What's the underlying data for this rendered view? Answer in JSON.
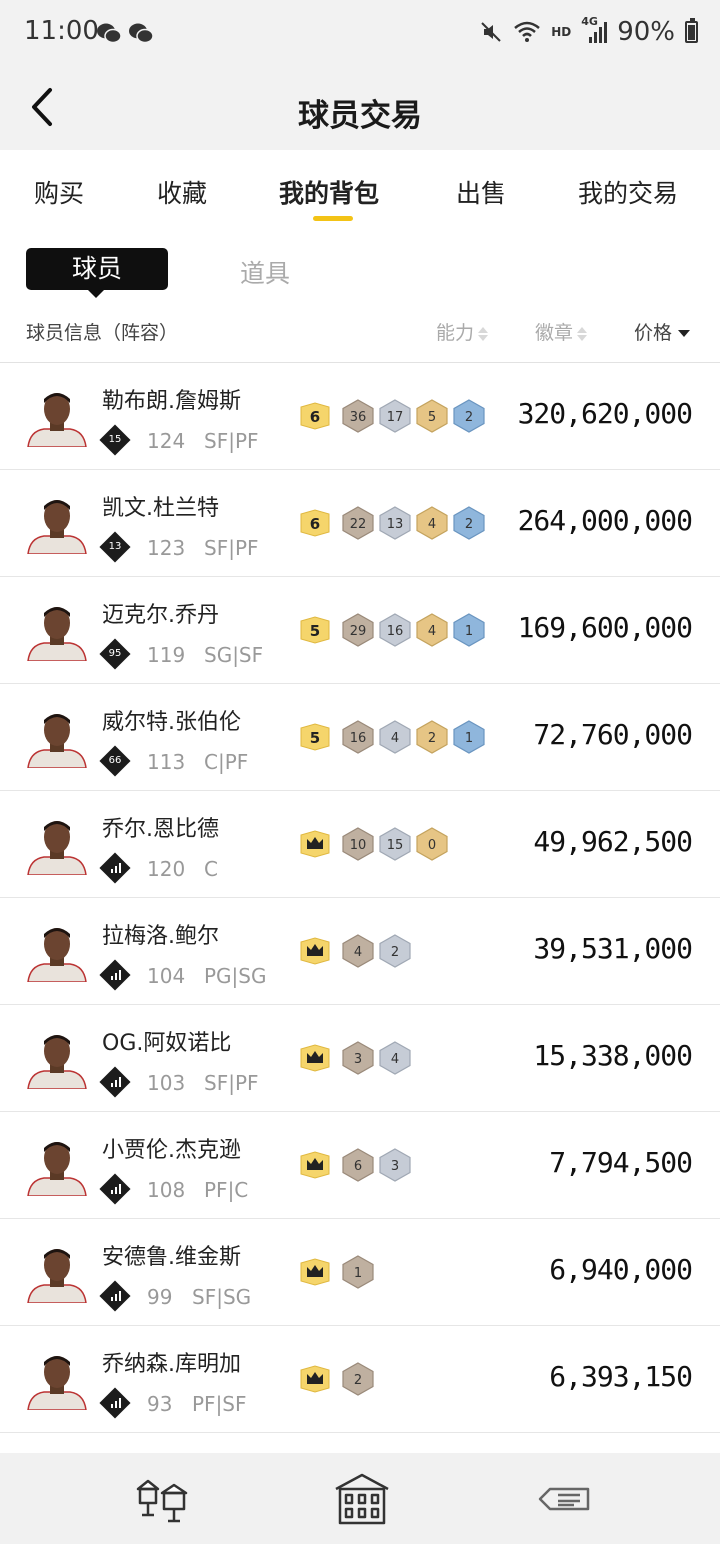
{
  "status": {
    "time": "11:00",
    "hd": "HD",
    "net": "4G",
    "battery": "90%"
  },
  "header": {
    "title": "球员交易"
  },
  "tabs": [
    {
      "label": "购买"
    },
    {
      "label": "收藏"
    },
    {
      "label": "我的背包"
    },
    {
      "label": "出售"
    },
    {
      "label": "我的交易"
    }
  ],
  "segment": {
    "player": "球员",
    "items": "道具"
  },
  "columns": {
    "info": "球员信息（阵容）",
    "ability": "能力",
    "badge": "徽章",
    "price": "价格"
  },
  "colors": {
    "accent": "#f3c316",
    "gold_badge": "#f5d56b",
    "bronze": "#bfb0a0",
    "silver": "#c6ccd6",
    "gold": "#e6c585",
    "hof": "#8fb6dc"
  },
  "players": [
    {
      "name": "勒布朗.詹姆斯",
      "rank": "15",
      "rating": "124",
      "position": "SF|PF",
      "level": "6",
      "badges": [
        "36",
        "17",
        "5",
        "2"
      ],
      "price": "320,620,000"
    },
    {
      "name": "凯文.杜兰特",
      "rank": "13",
      "rating": "123",
      "position": "SF|PF",
      "level": "6",
      "badges": [
        "22",
        "13",
        "4",
        "2"
      ],
      "price": "264,000,000"
    },
    {
      "name": "迈克尔.乔丹",
      "rank": "95",
      "rating": "119",
      "position": "SG|SF",
      "level": "5",
      "badges": [
        "29",
        "16",
        "4",
        "1"
      ],
      "price": "169,600,000"
    },
    {
      "name": "威尔特.张伯伦",
      "rank": "66",
      "rating": "113",
      "position": "C|PF",
      "level": "5",
      "badges": [
        "16",
        "4",
        "2",
        "1"
      ],
      "price": "72,760,000"
    },
    {
      "name": "乔尔.恩比德",
      "rank": "",
      "rating": "120",
      "position": "C",
      "level": "",
      "badges": [
        "10",
        "15",
        "0"
      ],
      "price": "49,962,500"
    },
    {
      "name": "拉梅洛.鲍尔",
      "rank": "",
      "rating": "104",
      "position": "PG|SG",
      "level": "",
      "badges": [
        "4",
        "2"
      ],
      "price": "39,531,000"
    },
    {
      "name": "OG.阿奴诺比",
      "rank": "",
      "rating": "103",
      "position": "SF|PF",
      "level": "",
      "badges": [
        "3",
        "4"
      ],
      "price": "15,338,000"
    },
    {
      "name": "小贾伦.杰克逊",
      "rank": "",
      "rating": "108",
      "position": "PF|C",
      "level": "",
      "badges": [
        "6",
        "3"
      ],
      "price": "7,794,500"
    },
    {
      "name": "安德鲁.维金斯",
      "rank": "",
      "rating": "99",
      "position": "SF|SG",
      "level": "",
      "badges": [
        "1"
      ],
      "price": "6,940,000"
    },
    {
      "name": "乔纳森.库明加",
      "rank": "",
      "rating": "93",
      "position": "PF|SF",
      "level": "",
      "badges": [
        "2"
      ],
      "price": "6,393,150"
    }
  ],
  "icons": {
    "back": "chevron-left-icon",
    "nav1": "lanterns-icon",
    "nav2": "building-icon",
    "nav3": "signpost-icon"
  }
}
